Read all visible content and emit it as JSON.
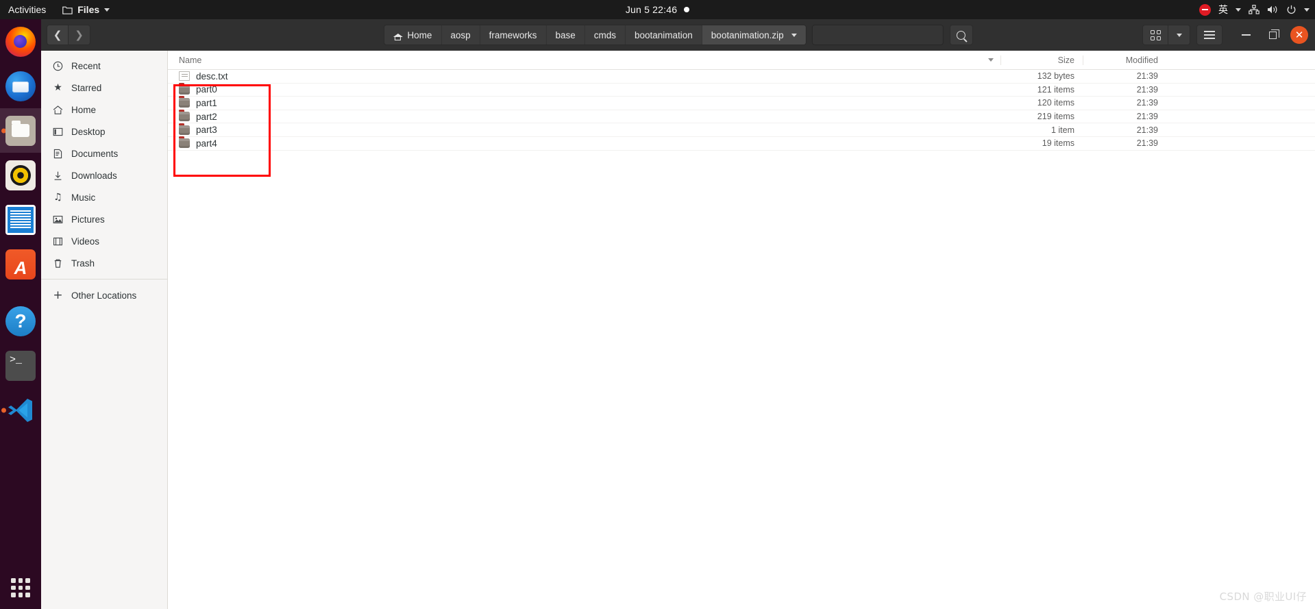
{
  "topbar": {
    "activities": "Activities",
    "app_name": "Files",
    "app_icon": "folder-icon",
    "clock": "Jun 5  22:46",
    "notification_dot": true,
    "tray": [
      {
        "name": "do-not-disturb-icon",
        "label": ""
      },
      {
        "name": "input-method-indicator",
        "label": "英"
      },
      {
        "name": "network-icon",
        "label": ""
      },
      {
        "name": "volume-icon",
        "label": ""
      },
      {
        "name": "power-icon",
        "label": ""
      },
      {
        "name": "system-menu-chevron-icon",
        "label": ""
      }
    ]
  },
  "dock": {
    "items": [
      {
        "name": "firefox",
        "icon": "firefox-icon",
        "running": false
      },
      {
        "name": "thunderbird",
        "icon": "thunderbird-icon",
        "running": false
      },
      {
        "name": "files",
        "icon": "files-icon",
        "running": true,
        "focused": true
      },
      {
        "name": "rhythmbox",
        "icon": "rhythmbox-icon",
        "running": false
      },
      {
        "name": "libreoffice-impress",
        "icon": "impress-icon",
        "running": false
      },
      {
        "name": "ubuntu-software",
        "icon": "software-icon",
        "running": false,
        "glyph": "A"
      },
      {
        "name": "help",
        "icon": "help-icon",
        "glyph": "?",
        "running": false
      },
      {
        "name": "terminal",
        "icon": "terminal-icon",
        "glyph": ">_",
        "running": false
      },
      {
        "name": "vscode",
        "icon": "vscode-icon",
        "running": true
      }
    ],
    "show_apps_label": "Show Applications"
  },
  "headerbar": {
    "back_glyph": "❮",
    "forward_glyph": "❯",
    "breadcrumbs": [
      {
        "label": "Home",
        "icon": "home-icon",
        "current": false
      },
      {
        "label": "aosp",
        "current": false
      },
      {
        "label": "frameworks",
        "current": false
      },
      {
        "label": "base",
        "current": false
      },
      {
        "label": "cmds",
        "current": false
      },
      {
        "label": "bootanimation",
        "current": false
      },
      {
        "label": "bootanimation.zip",
        "current": true,
        "has_dropdown": true
      }
    ],
    "path_entry_value": "",
    "search_icon": "search-icon",
    "view_grid_icon": "grid-view-icon",
    "view_dropdown_icon": "chevron-down-icon",
    "menu_icon": "hamburger-menu-icon",
    "minimize_icon": "minimize-icon",
    "maximize_icon": "maximize-icon",
    "close_icon": "close-icon",
    "close_glyph": "✕"
  },
  "sidebar": {
    "items": [
      {
        "label": "Recent",
        "icon": "clock-icon",
        "glyph": "◷"
      },
      {
        "label": "Starred",
        "icon": "star-icon",
        "glyph": "★"
      },
      {
        "label": "Home",
        "icon": "home-icon",
        "glyph": "⌂"
      },
      {
        "label": "Desktop",
        "icon": "desktop-icon",
        "glyph": "▣"
      },
      {
        "label": "Documents",
        "icon": "documents-icon",
        "glyph": "≡"
      },
      {
        "label": "Downloads",
        "icon": "downloads-icon",
        "glyph": "↧"
      },
      {
        "label": "Music",
        "icon": "music-icon",
        "glyph": "♫"
      },
      {
        "label": "Pictures",
        "icon": "pictures-icon",
        "glyph": "▧"
      },
      {
        "label": "Videos",
        "icon": "videos-icon",
        "glyph": "⌷"
      },
      {
        "label": "Trash",
        "icon": "trash-icon",
        "glyph": "⌧"
      }
    ],
    "other_locations": {
      "label": "Other Locations",
      "icon": "plus-icon",
      "glyph": "+"
    }
  },
  "file_list": {
    "columns": [
      "Name",
      "Size",
      "Modified"
    ],
    "sort_caret_icon": "sort-descending-icon",
    "rows": [
      {
        "name": "desc.txt",
        "icon": "text-file-icon",
        "type": "file",
        "size": "132 bytes",
        "modified": "21:39"
      },
      {
        "name": "part0",
        "icon": "folder-icon",
        "type": "folder",
        "size": "121 items",
        "modified": "21:39"
      },
      {
        "name": "part1",
        "icon": "folder-icon",
        "type": "folder",
        "size": "120 items",
        "modified": "21:39"
      },
      {
        "name": "part2",
        "icon": "folder-icon",
        "type": "folder",
        "size": "219 items",
        "modified": "21:39"
      },
      {
        "name": "part3",
        "icon": "folder-icon",
        "type": "folder",
        "size": "1 item",
        "modified": "21:39"
      },
      {
        "name": "part4",
        "icon": "folder-icon",
        "type": "folder",
        "size": "19 items",
        "modified": "21:39"
      }
    ]
  },
  "annotation": {
    "name": "red-highlight-box",
    "color": "#ff0000"
  },
  "watermark": "CSDN @职业UI仔",
  "colors": {
    "topbar_bg": "#1b1b1b",
    "dock_bg": "#2c0922",
    "headerbar_bg": "#303030",
    "sidebar_bg": "#f6f5f4",
    "list_bg": "#ffffff",
    "accent": "#e95420",
    "annotation": "#ff0000"
  }
}
